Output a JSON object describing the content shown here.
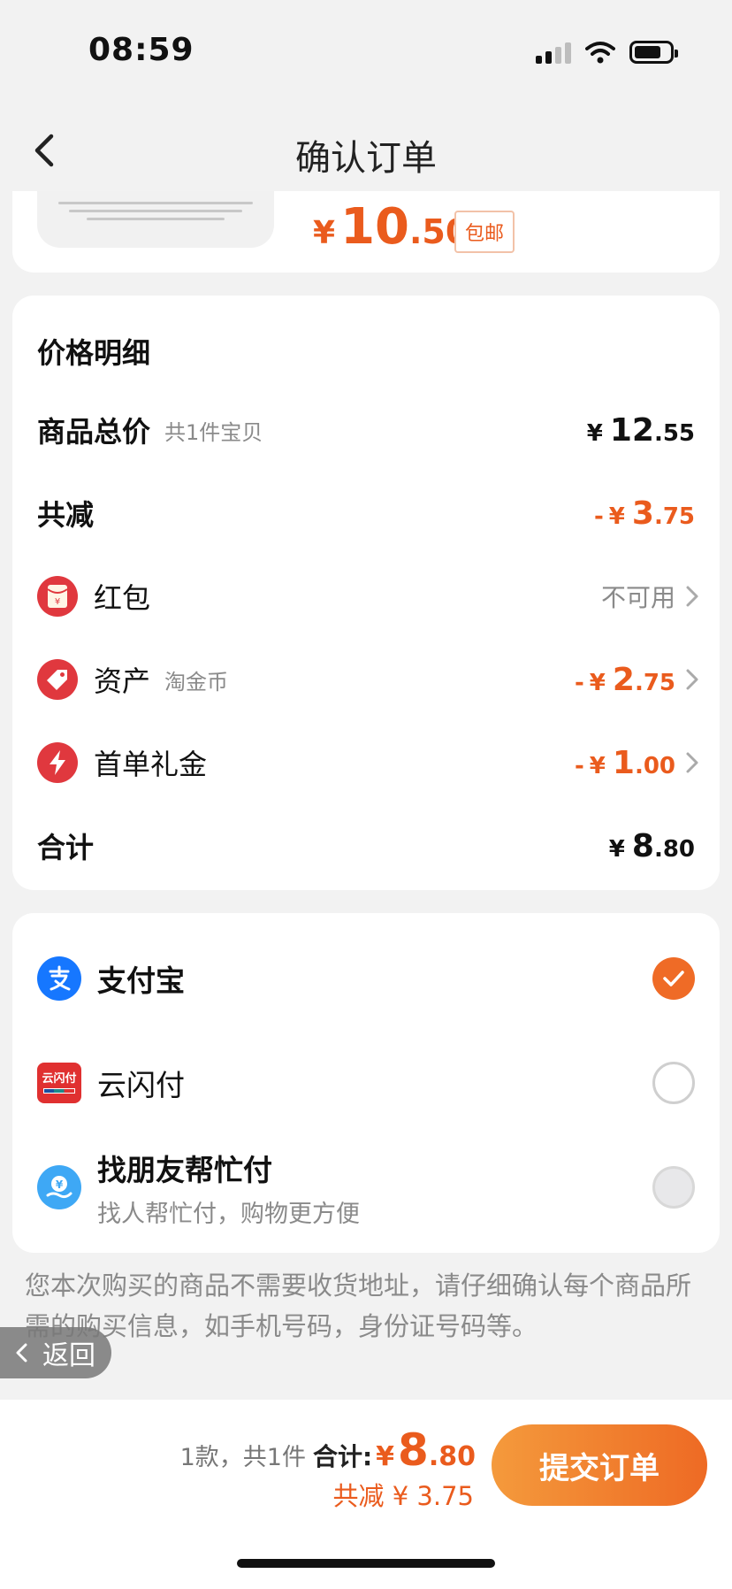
{
  "status_bar": {
    "time": "08:59"
  },
  "nav": {
    "title": "确认订单"
  },
  "product": {
    "price_currency": "¥",
    "price_int": "10",
    "price_dec": ".50",
    "shipping_tag": "包邮"
  },
  "price_detail": {
    "heading": "价格明细",
    "goods_total": {
      "label": "商品总价",
      "sub": "共1件宝贝",
      "cur": "¥",
      "int": "12",
      "dec": ".55"
    },
    "total_reduce": {
      "label": "共减",
      "sign": "-",
      "cur": "¥",
      "int": "3",
      "dec": ".75"
    },
    "red_packet": {
      "label": "红包",
      "value": "不可用",
      "icon": "red-envelope-icon"
    },
    "assets": {
      "label": "资产",
      "sub": "淘金币",
      "sign": "-",
      "cur": "¥",
      "int": "2",
      "dec": ".75",
      "icon": "tag-icon"
    },
    "first_order": {
      "label": "首单礼金",
      "sign": "-",
      "cur": "¥",
      "int": "1",
      "dec": ".00",
      "icon": "lightning-icon"
    },
    "sum": {
      "label": "合计",
      "cur": "¥",
      "int": "8",
      "dec": ".80"
    }
  },
  "payment": {
    "methods": [
      {
        "name": "支付宝",
        "icon": "alipay-icon",
        "selected": true
      },
      {
        "name": "云闪付",
        "icon": "unionpay-icon",
        "icon_text": "云闪付",
        "selected": false
      },
      {
        "name": "找朋友帮忙付",
        "sub": "找人帮忙付，购物更方便",
        "icon": "friend-pay-icon",
        "selected": false
      }
    ]
  },
  "notice": "您本次购买的商品不需要收货地址，请仔细确认每个商品所需的购买信息，如手机号码，身份证号码等。",
  "float_back": {
    "label": "返回"
  },
  "bottom": {
    "count": "1款，共1件",
    "total_label": "合计:",
    "total_cur": "¥",
    "total_int": "8",
    "total_dec": ".80",
    "discount": "共减 ¥ 3.75",
    "submit": "提交订单"
  },
  "colors": {
    "accent": "#ea5b1d",
    "button": "#ee6a24",
    "alipay": "#1677ff",
    "red": "#e0383e"
  }
}
